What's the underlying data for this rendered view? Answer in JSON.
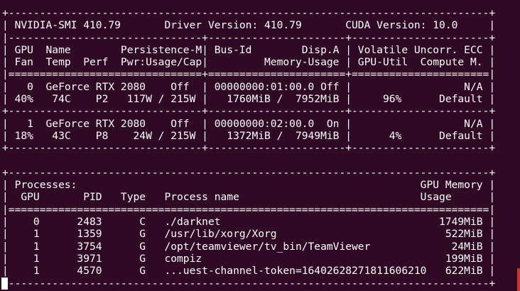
{
  "window": {
    "app": "terminal"
  },
  "terminal": {
    "lines": [
      "+-----------------------------------------------------------------------------+",
      "| NVIDIA-SMI 410.79       Driver Version: 410.79       CUDA Version: 10.0     |",
      "|-------------------------------+----------------------+----------------------+",
      "| GPU  Name        Persistence-M| Bus-Id        Disp.A | Volatile Uncorr. ECC |",
      "| Fan  Temp  Perf  Pwr:Usage/Cap|         Memory-Usage | GPU-Util  Compute M. |",
      "|===============================+======================+======================|",
      "|   0  GeForce RTX 2080    Off  | 00000000:01:00.0 Off |                  N/A |",
      "| 40%   74C    P2   117W / 215W |   1760MiB /  7952MiB |     96%      Default |",
      "+-------------------------------+----------------------+----------------------+",
      "|   1  GeForce RTX 2080    Off  | 00000000:02:00.0  On |                  N/A |",
      "| 18%   43C    P8    24W / 215W |   1372MiB /  7949MiB |      4%      Default |",
      "+-------------------------------+----------------------+----------------------+",
      "",
      "+-----------------------------------------------------------------------------+",
      "| Processes:                                                       GPU Memory |",
      "|  GPU       PID   Type   Process name                             Usage      |",
      "|=============================================================================|",
      "|    0      2483      C   ./darknet                                   1749MiB |",
      "|    1      1359      G   /usr/lib/xorg/Xorg                           522MiB |",
      "|    1      3754      G   /opt/teamviewer/tv_bin/TeamViewer             24MiB |",
      "|    1      3971      G   compiz                                       199MiB |",
      "|    1      4570      G   ...uest-channel-token=16402628271811606210   622MiB |",
      "+-----------------------------------------------------------------------------+"
    ]
  }
}
